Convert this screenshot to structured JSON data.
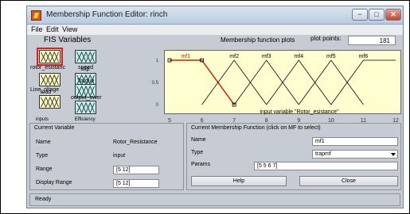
{
  "window": {
    "title": "Membership Function Editor: rinch"
  },
  "window_buttons": {
    "minimize": "−",
    "maximize": "□",
    "close": "✕"
  },
  "menu": {
    "items": [
      "File",
      "Edit",
      "View"
    ]
  },
  "fis_panel": {
    "title": "FIS Variables",
    "variables": [
      {
        "label": "Rotor_Resistance",
        "kind": "input",
        "selected": true
      },
      {
        "label": "speed",
        "kind": "output",
        "selected": false
      },
      {
        "label": "Line_Voltage",
        "kind": "input",
        "selected": false
      },
      {
        "label": "slip",
        "kind": "output",
        "selected": false
      },
      {
        "label": "load",
        "kind": "input",
        "selected": false
      },
      {
        "label": "Torque",
        "kind": "output",
        "selected": false
      },
      {
        "label": "output_power",
        "kind": "output",
        "selected": false
      },
      {
        "label": "Efficiency",
        "kind": "output",
        "selected": false
      }
    ],
    "shown_labels": {
      "rotor": "rotor_esistanc",
      "speed": "speed",
      "line": "Line_oltage",
      "slip": "slip",
      "load": "load",
      "torque": "Torque",
      "output_power": "output_ower",
      "inputs": "inputs",
      "efficiency": "Efficiency"
    }
  },
  "plot_header": {
    "title": "Membership function plots",
    "plot_points_label": "plot points:",
    "plot_points_value": "181"
  },
  "chart_data": {
    "type": "line",
    "xlabel": "input variable \"Rotor_Resistance\"",
    "xlabel_shown": "input variable \"Rotor_esistance\"",
    "xlim": [
      5,
      12
    ],
    "ylim": [
      0,
      1
    ],
    "xticks": [
      5,
      6,
      7,
      8,
      9,
      10,
      11,
      12
    ],
    "yticks": [
      0,
      0.5,
      1
    ],
    "highlight_color": "#cc2200",
    "line_color": "#000000",
    "series": [
      {
        "name": "mf1",
        "type": "trapmf",
        "points": [
          [
            5,
            1
          ],
          [
            6,
            1
          ],
          [
            7,
            0
          ]
        ],
        "selected": true
      },
      {
        "name": "mf2",
        "points": [
          [
            6,
            0
          ],
          [
            7,
            1
          ],
          [
            8,
            0
          ]
        ],
        "selected": false
      },
      {
        "name": "mf3",
        "points": [
          [
            7,
            0
          ],
          [
            8,
            1
          ],
          [
            9,
            0
          ]
        ],
        "selected": false
      },
      {
        "name": "mf4",
        "points": [
          [
            8,
            0
          ],
          [
            9,
            1
          ],
          [
            10,
            0
          ]
        ],
        "selected": false
      },
      {
        "name": "mf5",
        "points": [
          [
            9,
            0
          ],
          [
            10,
            1
          ],
          [
            11,
            0
          ]
        ],
        "selected": false
      },
      {
        "name": "mf6",
        "points": [
          [
            10,
            0
          ],
          [
            11,
            1
          ],
          [
            12,
            1
          ]
        ],
        "selected": false
      }
    ]
  },
  "current_variable": {
    "title": "Current Variable",
    "name_label": "Name",
    "name_value": "Rotor_Resistance",
    "type_label": "Type",
    "type_value": "input",
    "range_label": "Range",
    "range_value": "[5 12]",
    "display_range_label": "Display Range",
    "display_range_value": "[5 12]"
  },
  "current_mf": {
    "title": "Current Membership Function (click on MF to select)",
    "name_label": "Name",
    "name_value": "mf1",
    "type_label": "Type",
    "type_value": "trapmf",
    "params_label": "Params",
    "params_value": "[5 5 6 7]"
  },
  "buttons": {
    "help": "Help",
    "close": "Close"
  },
  "status": {
    "text": "Ready"
  }
}
